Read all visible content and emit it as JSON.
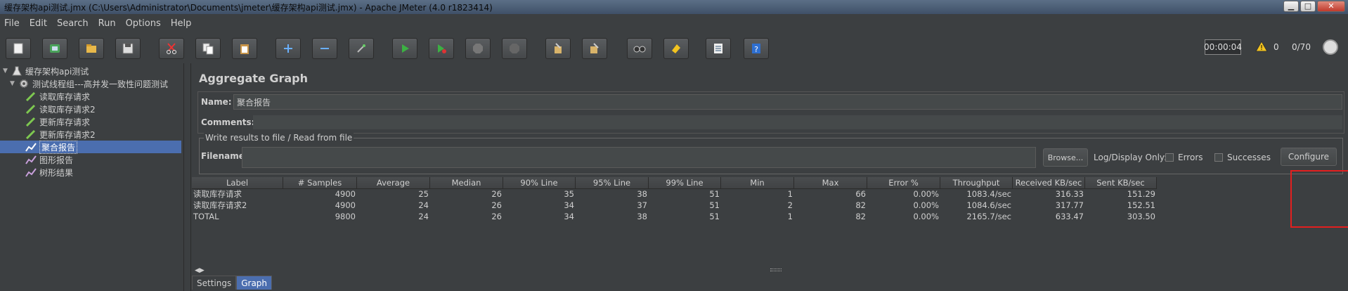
{
  "window": {
    "title": "缓存架构api测试.jmx (C:\\Users\\Administrator\\Documents\\jmeter\\缓存架构api测试.jmx) - Apache JMeter (4.0 r1823414)",
    "min": "▁",
    "max": "□",
    "close": "✕"
  },
  "menu": [
    "File",
    "Edit",
    "Search",
    "Run",
    "Options",
    "Help"
  ],
  "toolbar": {
    "buttons": [
      "new-icon",
      "templates-icon",
      "open-icon",
      "save-icon",
      "cut-icon",
      "copy-icon",
      "paste-icon",
      "expand-icon",
      "collapse-icon",
      "toggle-icon",
      "start-icon",
      "start-no-pause-icon",
      "stop-icon",
      "shutdown-icon",
      "clear-icon",
      "clear-all-icon",
      "search-icon",
      "reset-search-icon",
      "function-helper-icon",
      "help-icon"
    ],
    "timer": "00:00:04",
    "warnings": "0",
    "threads": "0/70"
  },
  "tree": {
    "items": [
      {
        "label": "缓存架构api测试",
        "level": 0
      },
      {
        "label": "测试线程组---高并发一致性问题测试",
        "level": 1
      },
      {
        "label": "读取库存请求",
        "level": 2
      },
      {
        "label": "读取库存请求2",
        "level": 2
      },
      {
        "label": "更新库存请求",
        "level": 2
      },
      {
        "label": "更新库存请求2",
        "level": 2
      },
      {
        "label": "聚合报告",
        "level": 2
      },
      {
        "label": "图形报告",
        "level": 2
      },
      {
        "label": "树形结果",
        "level": 2
      }
    ]
  },
  "panel": {
    "title": "Aggregate Graph",
    "name_label": "Name:",
    "name_value": "聚合报告",
    "comments_label": "Comments:",
    "comments_value": "",
    "write_legend": "Write results to file / Read from file",
    "filename_label": "Filename",
    "filename_value": "",
    "browse": "Browse...",
    "log_display": "Log/Display Only:",
    "errors": "Errors",
    "successes": "Successes",
    "configure": "Configure"
  },
  "table": {
    "headers": [
      "Label",
      "# Samples",
      "Average",
      "Median",
      "90% Line",
      "95% Line",
      "99% Line",
      "Min",
      "Max",
      "Error %",
      "Throughput",
      "Received KB/sec",
      "Sent KB/sec"
    ],
    "rows": [
      [
        "读取库存请求",
        "4900",
        "25",
        "26",
        "35",
        "38",
        "51",
        "1",
        "66",
        "0.00%",
        "1083.4/sec",
        "316.33",
        "151.29"
      ],
      [
        "读取库存请求2",
        "4900",
        "24",
        "26",
        "34",
        "37",
        "51",
        "2",
        "82",
        "0.00%",
        "1084.6/sec",
        "317.77",
        "152.51"
      ],
      [
        "TOTAL",
        "9800",
        "24",
        "26",
        "34",
        "38",
        "51",
        "1",
        "82",
        "0.00%",
        "2165.7/sec",
        "633.47",
        "303.50"
      ]
    ]
  },
  "tabs": [
    "Settings",
    "Graph"
  ],
  "colors": {
    "selection": "#4b6eaf",
    "highlight": "#e31f1f",
    "background": "#3c3f41"
  }
}
